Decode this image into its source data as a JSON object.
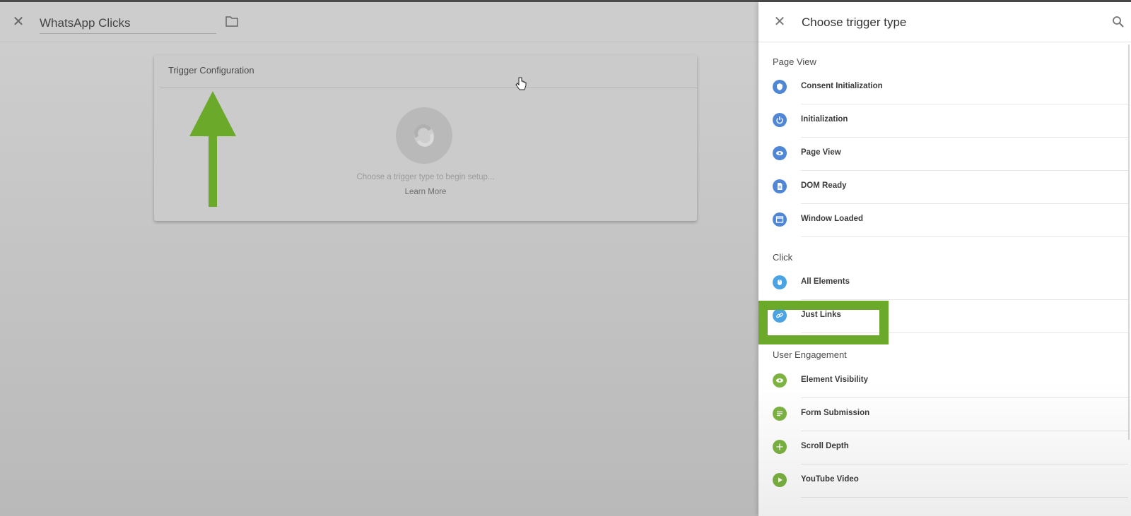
{
  "editor": {
    "trigger_name": "WhatsApp Clicks",
    "card": {
      "title": "Trigger Configuration",
      "hint": "Choose a trigger type to begin setup...",
      "learn_more": "Learn More"
    }
  },
  "panel": {
    "title": "Choose trigger type",
    "sections": [
      {
        "label": "Page View",
        "items": [
          {
            "label": "Consent Initialization",
            "icon": "shield-icon",
            "color": "#4f86d6"
          },
          {
            "label": "Initialization",
            "icon": "power-icon",
            "color": "#4f86d6"
          },
          {
            "label": "Page View",
            "icon": "eye-icon",
            "color": "#4f86d6"
          },
          {
            "label": "DOM Ready",
            "icon": "document-icon",
            "color": "#4f86d6"
          },
          {
            "label": "Window Loaded",
            "icon": "window-icon",
            "color": "#4f86d6"
          }
        ]
      },
      {
        "label": "Click",
        "items": [
          {
            "label": "All Elements",
            "icon": "cursor-click-icon",
            "color": "#4ba3e3"
          },
          {
            "label": "Just Links",
            "icon": "link-icon",
            "color": "#4ba3e3"
          }
        ]
      },
      {
        "label": "User Engagement",
        "items": [
          {
            "label": "Element Visibility",
            "icon": "eye-icon",
            "color": "#7cb342"
          },
          {
            "label": "Form Submission",
            "icon": "form-icon",
            "color": "#7cb342"
          },
          {
            "label": "Scroll Depth",
            "icon": "arrows-icon",
            "color": "#7cb342"
          },
          {
            "label": "YouTube Video",
            "icon": "play-icon",
            "color": "#7cb342"
          }
        ]
      }
    ]
  },
  "annotations": {
    "highlight_color": "#6aa92a",
    "arrow_color": "#6aa92a"
  }
}
